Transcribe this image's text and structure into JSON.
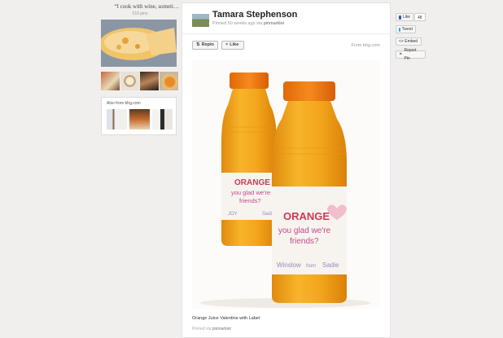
{
  "board": {
    "title": "“I cook with wine, someti…",
    "pin_count": "516 pins",
    "also_from_title": "Also from bhg.com"
  },
  "pin": {
    "user_name": "Tamara Stephenson",
    "pinned_ago": "Pinned 50 weeks ago via",
    "pinned_via_app": "pinmarklet",
    "repin_label": "Repin",
    "like_label": "Like",
    "source": "From bhg.com",
    "caption": "Orange Juice Valentine with Label",
    "footer_prefix": "Pinned via",
    "footer_app": "pinmarklet"
  },
  "image": {
    "label_line1": "ORANGE",
    "label_line2": "you glad we're",
    "label_line3": "friends?",
    "label_to": "Winslow",
    "label_from": "from",
    "label_from_name": "Sadie",
    "back_label_to": "JOY",
    "back_label_from_name": "Sadie"
  },
  "share": {
    "fb_like_label": "Like",
    "fb_like_count": "48",
    "tweet_label": "Tweet",
    "embed_label": "<> Embed",
    "report_label": "Report Pin"
  },
  "colors": {
    "background": "#f1efee",
    "juice": "#f2a31b",
    "cap": "#f07a14",
    "label_text": "#cc3a55",
    "facebook": "#3b5998",
    "twitter": "#2aa9e0"
  }
}
